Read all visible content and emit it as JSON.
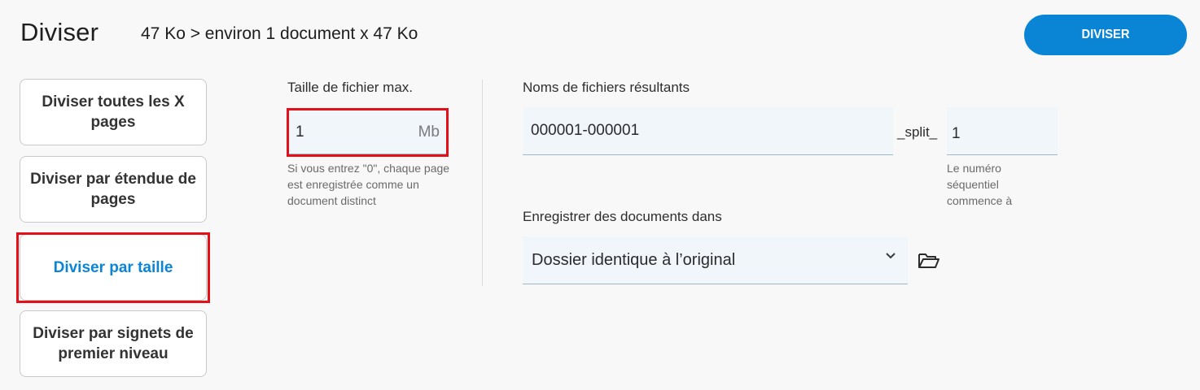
{
  "header": {
    "title": "Diviser",
    "size_info": "47 Ko > environ 1 document x 47 Ko",
    "divide_button_label": "DIVISER"
  },
  "modes": [
    {
      "label": "Diviser toutes les X pages",
      "selected": false
    },
    {
      "label": "Diviser par étendue de pages",
      "selected": false
    },
    {
      "label": "Diviser par taille",
      "selected": true
    },
    {
      "label": "Diviser par signets de premier niveau",
      "selected": false
    }
  ],
  "max_size": {
    "label": "Taille de fichier max.",
    "value": "1",
    "unit": "Mb",
    "help": "Si vous entrez \"0\", chaque page est enregistrée comme un document distinct"
  },
  "filenames": {
    "label": "Noms de fichiers résultants",
    "base_value": "000001-000001",
    "separator": "_split_",
    "seq_value": "1",
    "seq_help": "Le numéro séquentiel commence à"
  },
  "save_location": {
    "label": "Enregistrer des documents dans",
    "selected": "Dossier identique à l’original"
  },
  "colors": {
    "accent": "#0a85d6",
    "highlight": "#e3101a"
  },
  "icons": {
    "folder": "folder-open-icon",
    "dropdown": "chevron-down-icon"
  }
}
